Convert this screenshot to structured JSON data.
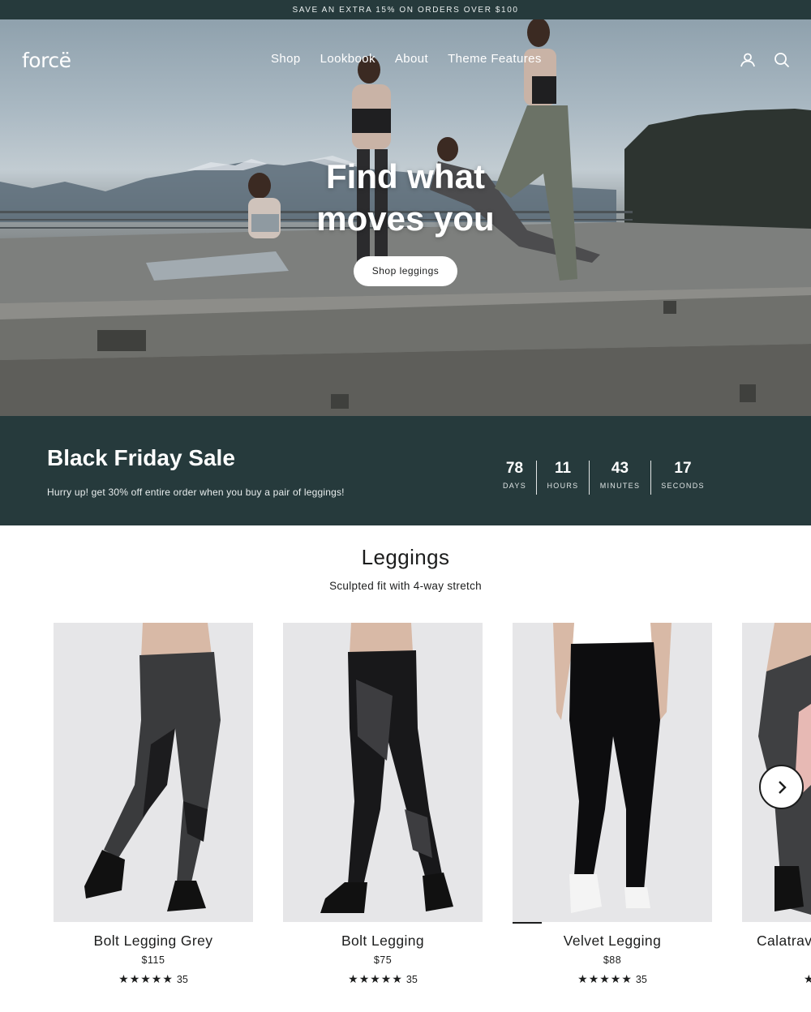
{
  "announcement": {
    "text": "SAVE AN EXTRA 15% ON ORDERS OVER $100"
  },
  "header": {
    "logo": "forcë",
    "nav": [
      "Shop",
      "Lookbook",
      "About",
      "Theme Features"
    ],
    "icons": [
      "account-icon",
      "search-icon"
    ]
  },
  "hero": {
    "title_line1": "Find what",
    "title_line2": "moves you",
    "button_label": "Shop leggings"
  },
  "countdown": {
    "title": "Black Friday Sale",
    "subtitle": "Hurry up! get 30% off entire order when you buy a pair of leggings!",
    "units": [
      {
        "value": "78",
        "label": "DAYS"
      },
      {
        "value": "11",
        "label": "HOURS"
      },
      {
        "value": "43",
        "label": "MINUTES"
      },
      {
        "value": "17",
        "label": "SECONDS"
      }
    ]
  },
  "collection": {
    "title": "Leggings",
    "subtitle": "Sculpted fit with 4-way stretch",
    "products": [
      {
        "name": "Bolt Legging Grey",
        "price": "$115",
        "stars": "★★★★★",
        "reviews": "35"
      },
      {
        "name": "Bolt Legging",
        "price": "$75",
        "stars": "★★★★★",
        "reviews": "35"
      },
      {
        "name": "Velvet Legging",
        "price": "$88",
        "stars": "★★★★★",
        "reviews": "35"
      },
      {
        "name": "Calatrava Legging",
        "price": "",
        "stars": "★",
        "reviews": ""
      }
    ],
    "next_icon": "chevron-right-icon"
  },
  "colors": {
    "dark_teal": "#263a3c",
    "text": "#1c1d1d",
    "white": "#ffffff"
  }
}
